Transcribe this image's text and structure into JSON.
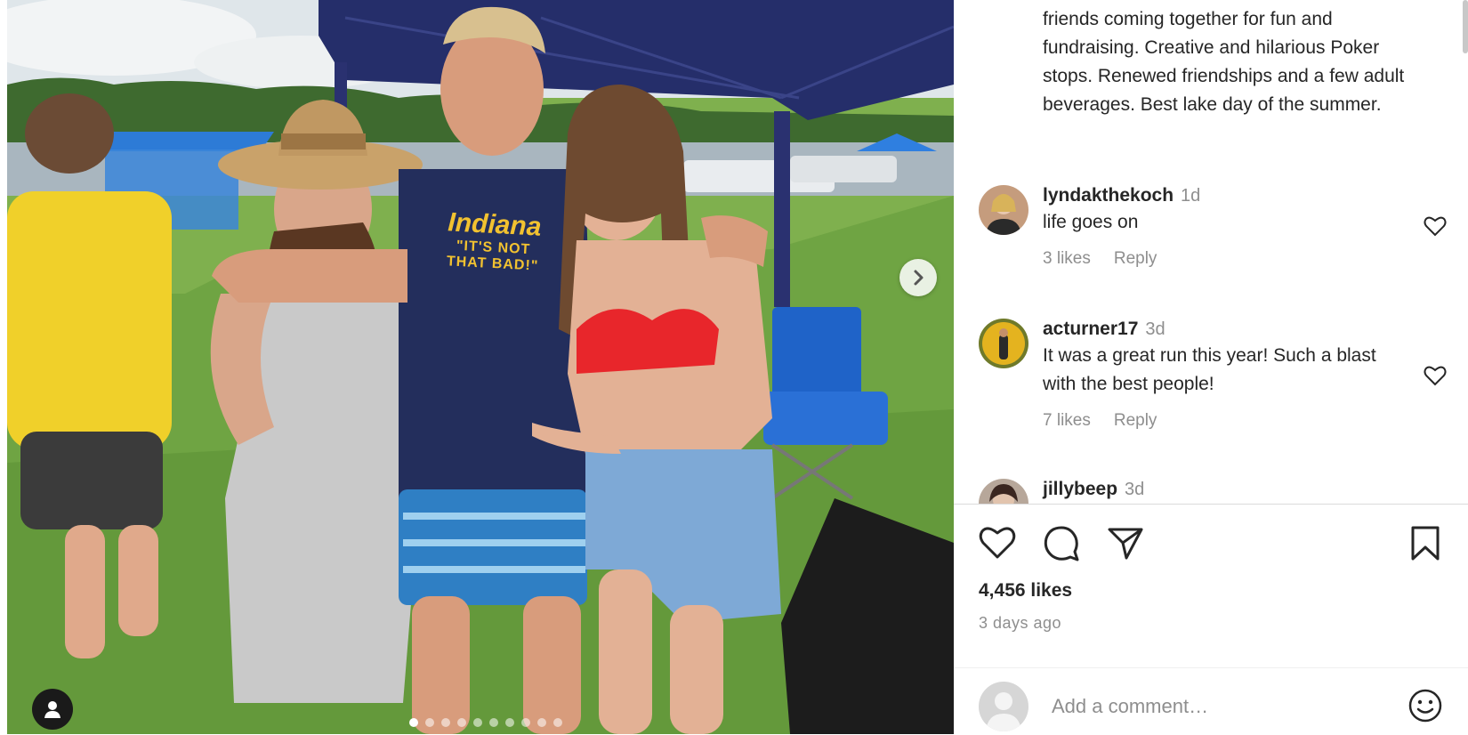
{
  "post": {
    "caption": "friends coming together for fun and fundraising. Creative and hilarious Poker stops. Renewed friendships and a few adult beverages. Best lake day of the summer.",
    "shirt_text_line1": "Indiana",
    "shirt_text_line2": "\"IT'S NOT",
    "shirt_text_line3": "THAT BAD!\"",
    "likes": "4,456 likes",
    "posted": "3 days ago",
    "carousel_count": 10,
    "carousel_active_index": 0
  },
  "comments": [
    {
      "user": "lyndakthekoch",
      "time": "1d",
      "text": "life goes on",
      "likes": "3 likes",
      "reply": "Reply"
    },
    {
      "user": "acturner17",
      "time": "3d",
      "text": "It was a great run this year! Such a blast with the best people!",
      "likes": "7 likes",
      "reply": "Reply"
    },
    {
      "user": "jillybeep",
      "time": "3d"
    }
  ],
  "add_comment": {
    "placeholder": "Add a comment…"
  },
  "icons": {
    "like": "heart-icon",
    "comment": "speech-bubble-icon",
    "share": "paper-plane-icon",
    "save": "bookmark-icon",
    "next": "chevron-right-icon",
    "tags": "user-tag-icon",
    "emoji": "emoji-icon"
  },
  "colors": {
    "text": "#262626",
    "muted": "#8e8e8e",
    "divider": "#dbdbdb"
  }
}
